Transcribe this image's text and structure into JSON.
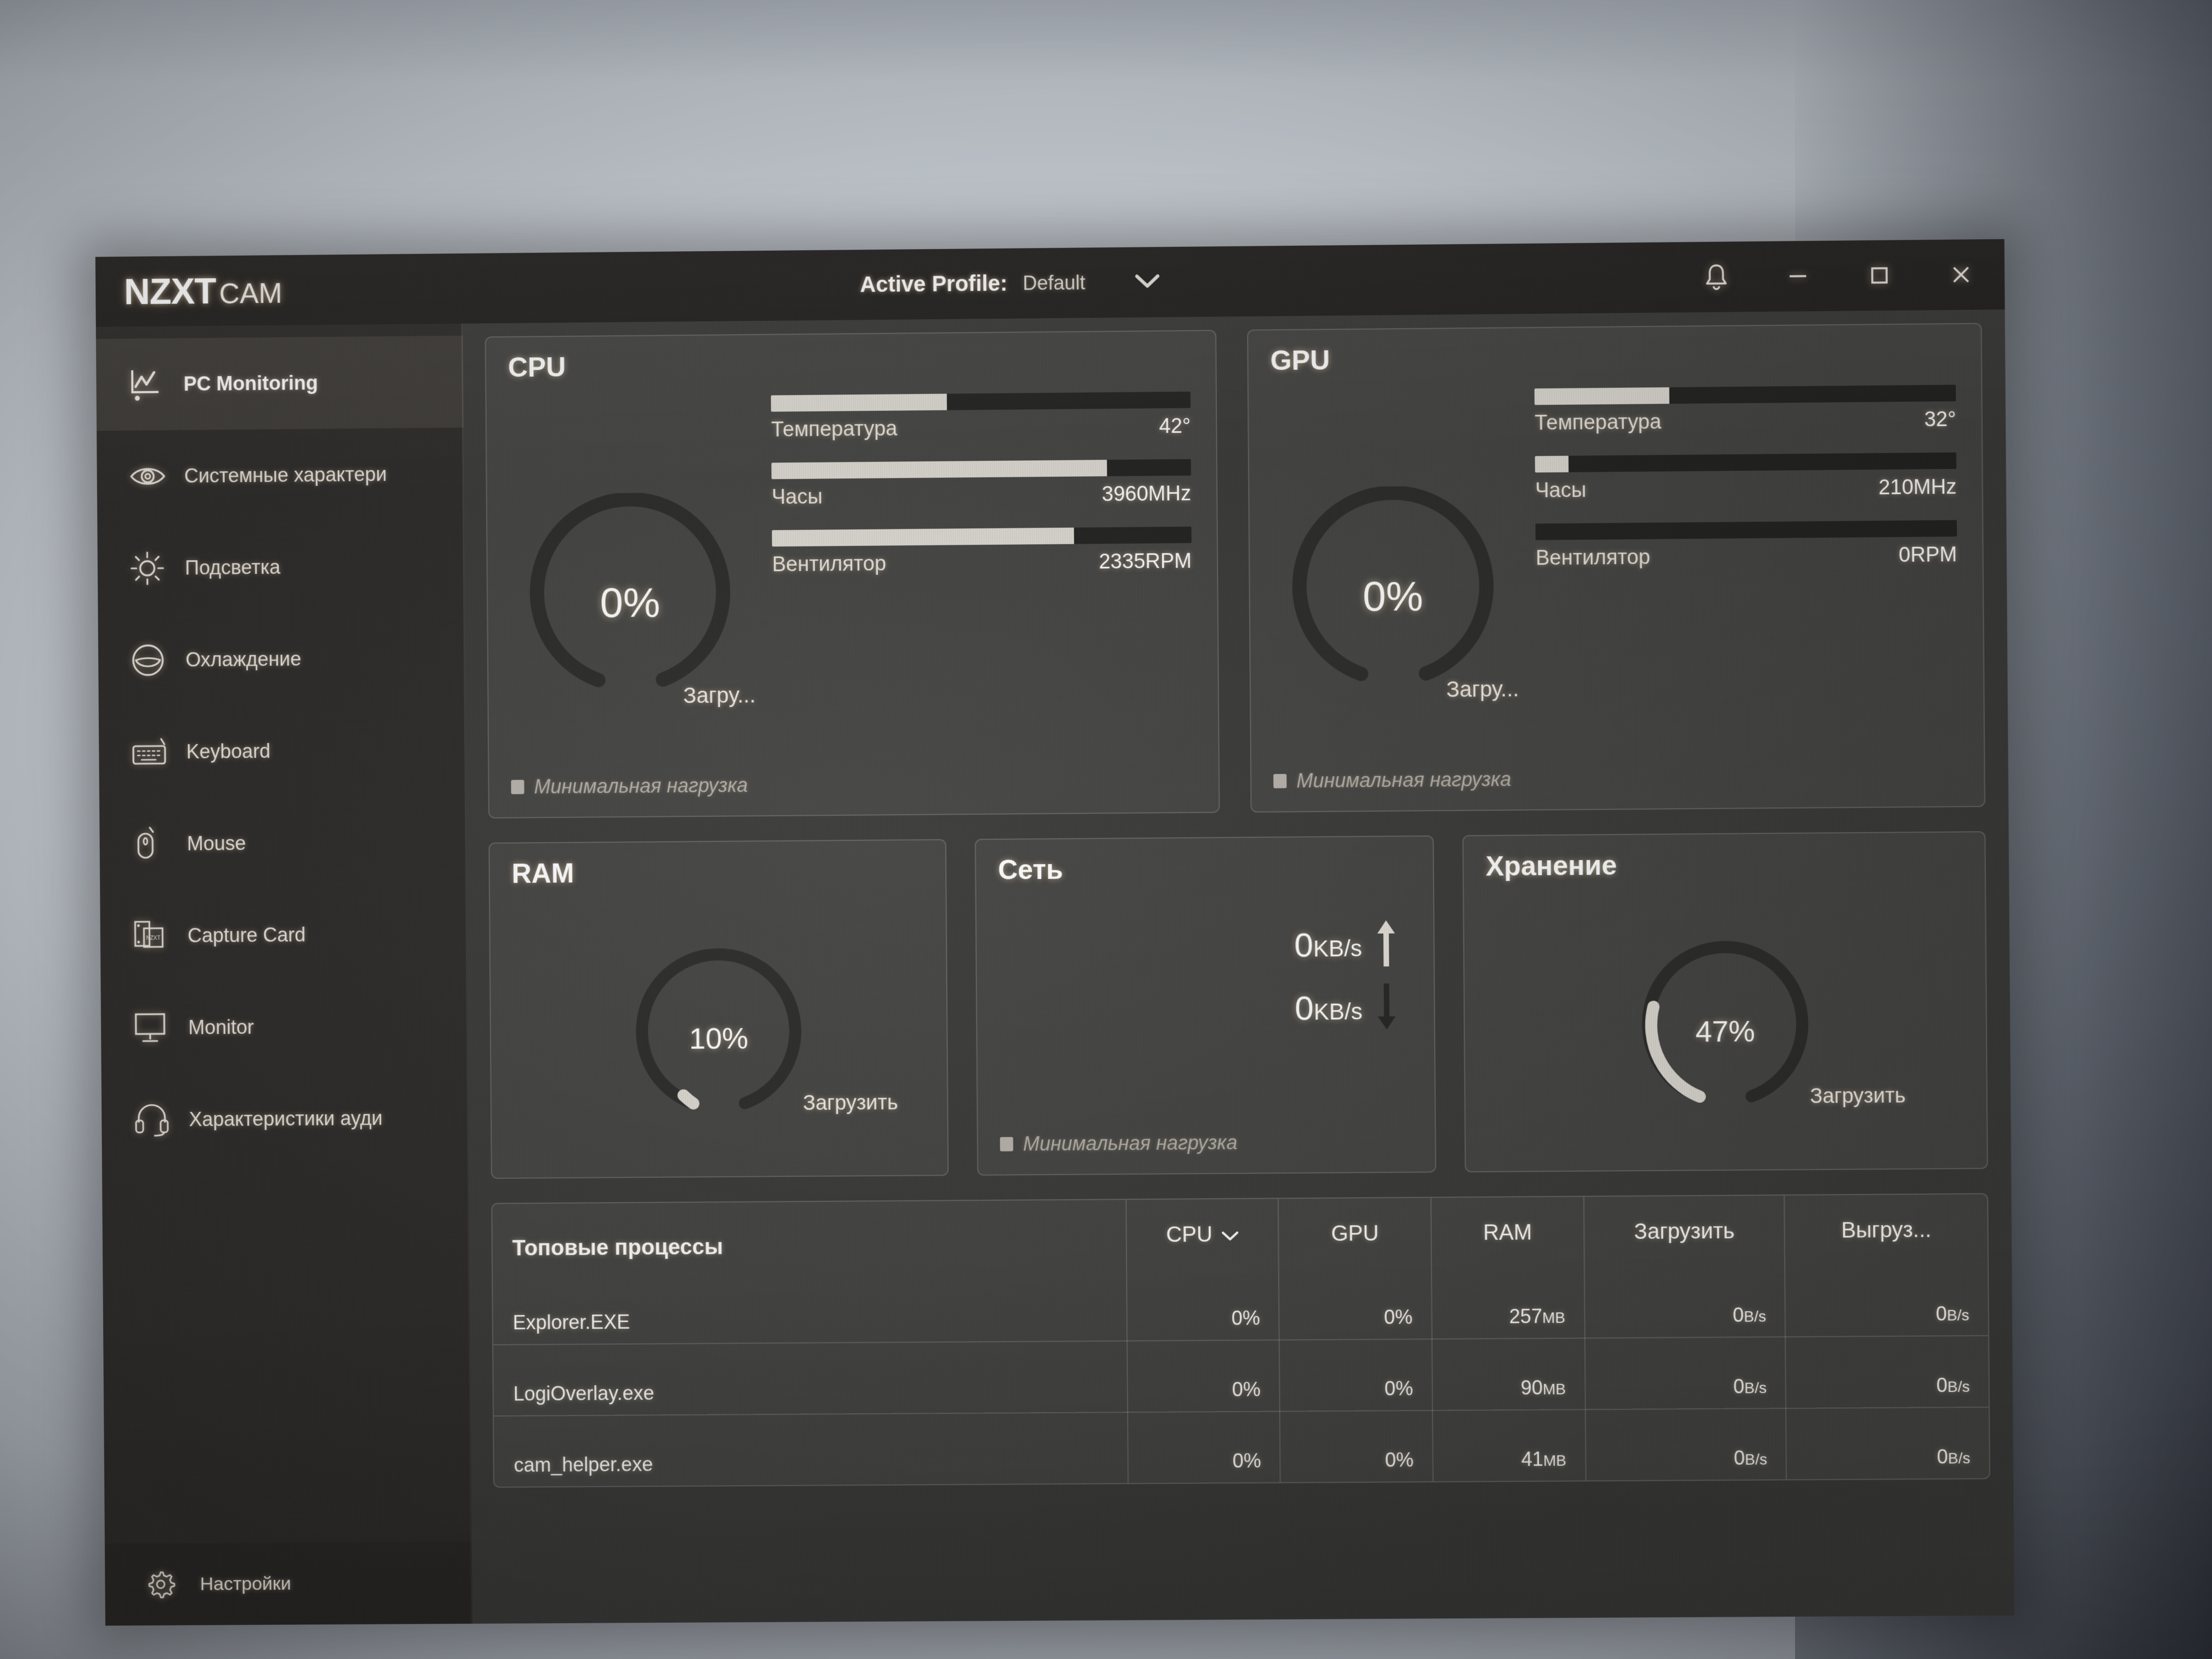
{
  "app": {
    "brand_primary": "NZXT",
    "brand_secondary": "CAM",
    "accent_color": "#ffffff",
    "titlebar_color": "#23211f",
    "sidebar_color": "#2e2c2a",
    "content_color": "#3b3b3a",
    "card_color": "#454543"
  },
  "titlebar": {
    "profile_label": "Active Profile:",
    "profile_value": "Default",
    "profile_chevron": "chevron-down-icon",
    "controls": {
      "notifications": "bell-icon",
      "minimize": "minimize-icon",
      "maximize": "maximize-icon",
      "close": "close-icon"
    }
  },
  "sidebar": {
    "items": [
      {
        "label": "PC Monitoring",
        "icon": "chart-line-icon",
        "active": true
      },
      {
        "label": "Системные характери",
        "icon": "eye-icon",
        "active": false
      },
      {
        "label": "Подсветка",
        "icon": "sun-icon",
        "active": false
      },
      {
        "label": "Охлаждение",
        "icon": "fan-circle-icon",
        "active": false
      },
      {
        "label": "Keyboard",
        "icon": "keyboard-icon",
        "active": false
      },
      {
        "label": "Mouse",
        "icon": "mouse-icon",
        "active": false
      },
      {
        "label": "Capture Card",
        "icon": "capture-card-icon",
        "active": false
      },
      {
        "label": "Monitor",
        "icon": "monitor-icon",
        "active": false
      },
      {
        "label": "Характеристики ауди",
        "icon": "headset-icon",
        "active": false
      }
    ],
    "settings": {
      "label": "Настройки",
      "icon": "gear-icon"
    }
  },
  "cards": {
    "cpu": {
      "title": "CPU",
      "usage_pct": "0%",
      "usage_value": 0,
      "usage_sub": "Загру...",
      "stats": [
        {
          "name": "Температура",
          "value": "42°",
          "fill_pct": 42
        },
        {
          "name": "Часы",
          "value": "3960MHz",
          "fill_pct": 80
        },
        {
          "name": "Вентилятор",
          "value": "2335RPM",
          "fill_pct": 72
        }
      ],
      "load_note": "Минимальная нагрузка"
    },
    "gpu": {
      "title": "GPU",
      "usage_pct": "0%",
      "usage_value": 0,
      "usage_sub": "Загру...",
      "stats": [
        {
          "name": "Температура",
          "value": "32°",
          "fill_pct": 32
        },
        {
          "name": "Часы",
          "value": "210MHz",
          "fill_pct": 8
        },
        {
          "name": "Вентилятор",
          "value": "0RPM",
          "fill_pct": 0
        }
      ],
      "load_note": "Минимальная нагрузка"
    },
    "ram": {
      "title": "RAM",
      "usage_pct": "10%",
      "usage_value": 10,
      "usage_sub": "Загрузить"
    },
    "network": {
      "title": "Сеть",
      "upload_value": "0",
      "upload_unit": "KB/s",
      "upload_icon": "arrow-up-icon",
      "download_value": "0",
      "download_unit": "KB/s",
      "download_icon": "arrow-down-icon",
      "load_note": "Минимальная нагрузка"
    },
    "storage": {
      "title": "Хранение",
      "usage_pct": "47%",
      "usage_value": 47,
      "usage_sub": "Загрузить"
    }
  },
  "processes": {
    "title": "Топовые процессы",
    "columns": [
      {
        "label": "CPU",
        "sorted": true,
        "sort_icon": "chevron-down-icon"
      },
      {
        "label": "GPU",
        "sorted": false
      },
      {
        "label": "RAM",
        "sorted": false
      },
      {
        "label": "Загрузить",
        "sorted": false
      },
      {
        "label": "Выгруз...",
        "sorted": false
      }
    ],
    "rows": [
      {
        "name": "Explorer.EXE",
        "cpu": "0%",
        "gpu": "0%",
        "ram": "257",
        "ram_unit": "MB",
        "download": "0",
        "download_unit": "B/s",
        "upload": "0",
        "upload_unit": "B/s"
      },
      {
        "name": "LogiOverlay.exe",
        "cpu": "0%",
        "gpu": "0%",
        "ram": "90",
        "ram_unit": "MB",
        "download": "0",
        "download_unit": "B/s",
        "upload": "0",
        "upload_unit": "B/s"
      },
      {
        "name": "cam_helper.exe",
        "cpu": "0%",
        "gpu": "0%",
        "ram": "41",
        "ram_unit": "MB",
        "download": "0",
        "download_unit": "B/s",
        "upload": "0",
        "upload_unit": "B/s"
      }
    ]
  }
}
